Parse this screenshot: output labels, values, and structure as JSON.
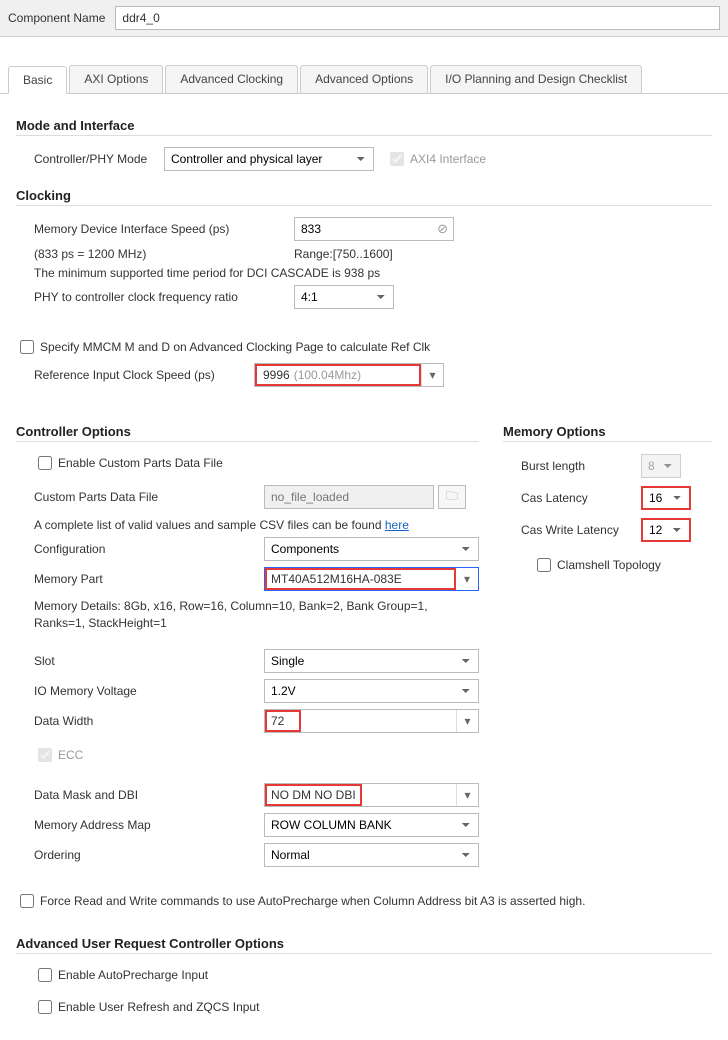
{
  "header": {
    "component_name_label": "Component Name",
    "component_name_value": "ddr4_0"
  },
  "tabs": [
    "Basic",
    "AXI Options",
    "Advanced Clocking",
    "Advanced Options",
    "I/O Planning and Design Checklist"
  ],
  "active_tab": "Basic",
  "mode_interface": {
    "title": "Mode and Interface",
    "controller_phy_label": "Controller/PHY Mode",
    "controller_phy_value": "Controller and physical layer",
    "axi4_label": "AXI4 Interface"
  },
  "clocking": {
    "title": "Clocking",
    "mem_speed_label": "Memory Device Interface Speed (ps)",
    "mem_speed_value": "833",
    "mem_speed_note": "(833 ps = 1200 MHz)",
    "mem_speed_range": "Range:[750..1600]",
    "dci_note": "The minimum supported time period for DCI CASCADE is 938 ps",
    "phy_ratio_label": "PHY to controller clock frequency ratio",
    "phy_ratio_value": "4:1",
    "mmcm_label": "Specify MMCM M and D on Advanced Clocking Page to calculate Ref Clk",
    "ref_clk_label": "Reference Input Clock Speed (ps)",
    "ref_clk_value": "9996",
    "ref_clk_hz": "(100.04Mhz)"
  },
  "controller_options": {
    "title": "Controller Options",
    "enable_custom_label": "Enable Custom Parts Data File",
    "custom_parts_label": "Custom Parts Data File",
    "custom_parts_placeholder": "no_file_loaded",
    "csv_note_prefix": "A complete list of valid values and sample CSV files can be found ",
    "csv_note_link": "here",
    "configuration_label": "Configuration",
    "configuration_value": "Components",
    "memory_part_label": "Memory Part",
    "memory_part_value": "MT40A512M16HA-083E",
    "memory_details": "Memory Details: 8Gb, x16, Row=16, Column=10, Bank=2, Bank Group=1, Ranks=1, StackHeight=1",
    "slot_label": "Slot",
    "slot_value": "Single",
    "io_voltage_label": "IO Memory Voltage",
    "io_voltage_value": "1.2V",
    "data_width_label": "Data Width",
    "data_width_value": "72",
    "ecc_label": "ECC",
    "dm_dbi_label": "Data Mask and DBI",
    "dm_dbi_value": "NO DM NO DBI",
    "addr_map_label": "Memory Address Map",
    "addr_map_value": "ROW COLUMN BANK",
    "ordering_label": "Ordering",
    "ordering_value": "Normal",
    "force_rw_label": "Force Read and Write commands to use AutoPrecharge when Column Address bit A3 is asserted high."
  },
  "memory_options": {
    "title": "Memory Options",
    "burst_label": "Burst length",
    "burst_value": "8",
    "cas_latency_label": "Cas Latency",
    "cas_latency_value": "16",
    "cas_write_label": "Cas Write Latency",
    "cas_write_value": "12",
    "clamshell_label": "Clamshell Topology"
  },
  "advanced_user": {
    "title": "Advanced User Request Controller Options",
    "autoprecharge_label": "Enable AutoPrecharge Input",
    "user_refresh_label": "Enable User Refresh and ZQCS Input"
  }
}
